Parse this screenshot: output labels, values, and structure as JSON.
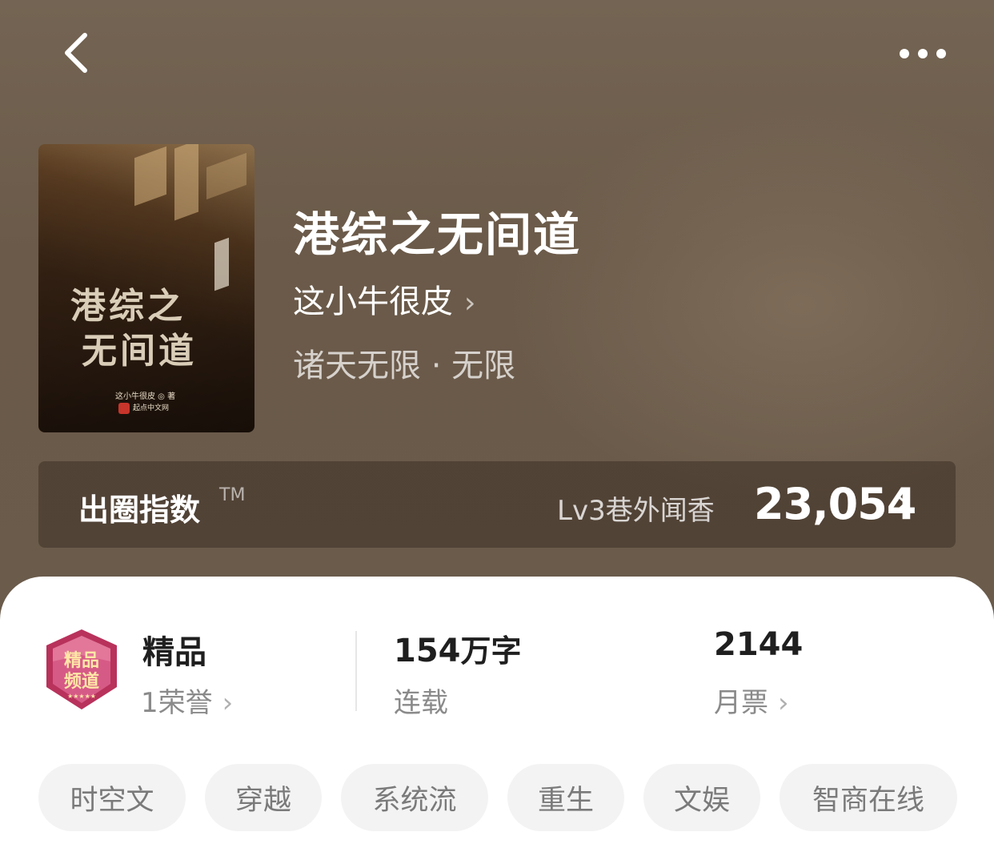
{
  "header": {
    "back_icon": "chevron-left-icon",
    "more_icon": "more-dots-icon"
  },
  "book": {
    "title": "港综之无间道",
    "author": "这小牛很皮",
    "genre": "诸天无限 · 无限",
    "cover": {
      "title_line1": "港综之",
      "title_line2": "无间道",
      "author_line": "这小牛很皮 ◎ 著",
      "publisher": "起点中文网"
    }
  },
  "index": {
    "label": "出圈指数",
    "tm": "TM",
    "level": "Lv3巷外闻香",
    "value": "23,054"
  },
  "stats": {
    "quality_badge": "精品频道",
    "quality_title": "精品",
    "quality_sub": "1荣誉",
    "words_number": "154",
    "words_unit": "万字",
    "words_sub": "连载",
    "tickets_number": "2144",
    "tickets_sub": "月票"
  },
  "tags": [
    "时空文",
    "穿越",
    "系统流",
    "重生",
    "文娱",
    "智商在线"
  ],
  "colors": {
    "hero_bg": "#6b5a49",
    "badge_pink": "#c2406a",
    "tag_bg": "#f3f3f3"
  }
}
